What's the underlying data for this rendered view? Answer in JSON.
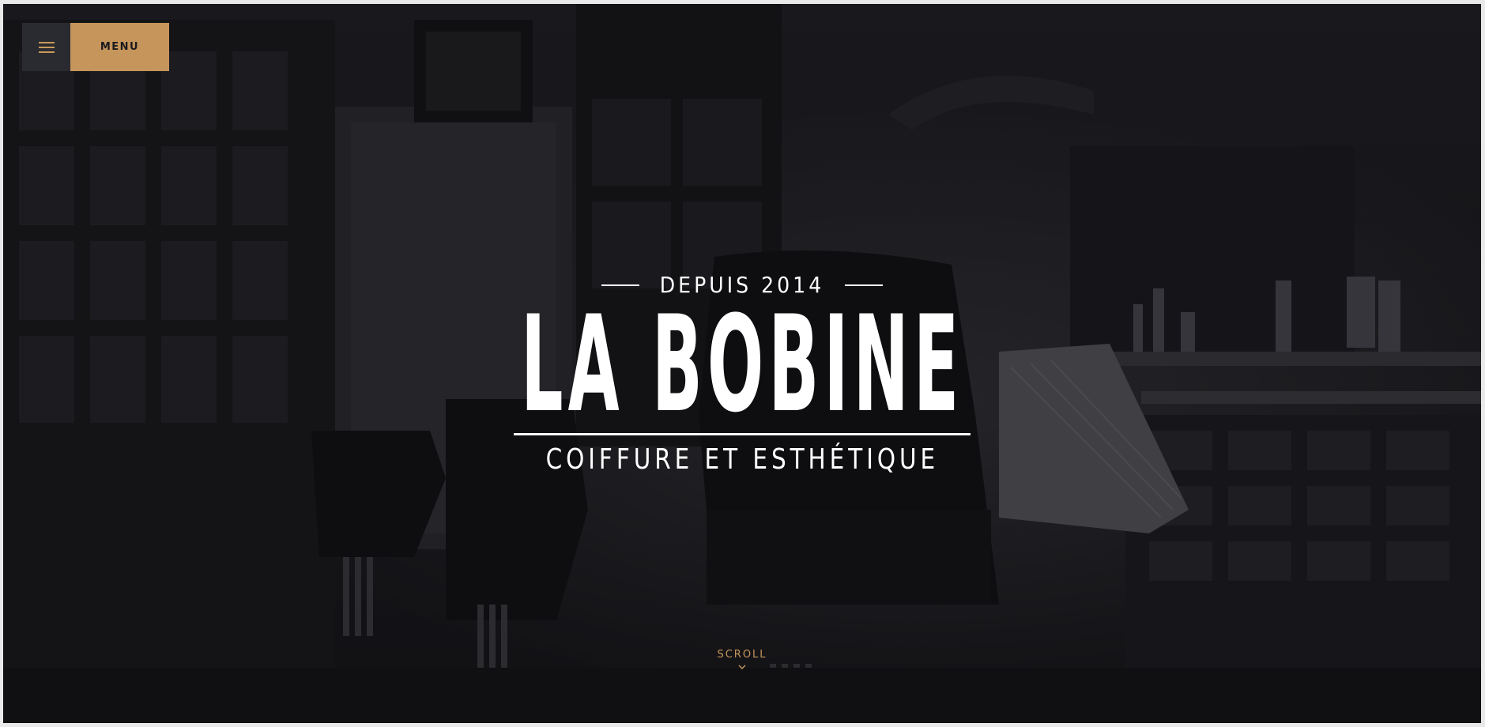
{
  "header": {
    "menu_label": "MENU",
    "hamburger_icon": "hamburger-icon"
  },
  "hero": {
    "since": "DEPUIS 2014",
    "brand": "LA BOBINE",
    "subtitle": "COIFFURE ET ESTHÉTIQUE"
  },
  "scroll": {
    "label": "SCROLL",
    "icon": "chevron-down-icon"
  },
  "colors": {
    "accent": "#c6955b",
    "background": "#1b1b1f",
    "text": "#ffffff"
  }
}
